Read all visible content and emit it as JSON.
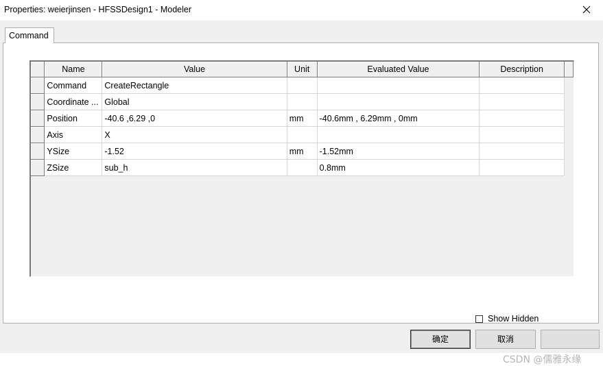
{
  "window": {
    "title": "Properties: weierjinsen - HFSSDesign1 - Modeler"
  },
  "tabs": [
    {
      "label": "Command"
    }
  ],
  "table": {
    "columns": [
      "Name",
      "Value",
      "Unit",
      "Evaluated Value",
      "Description"
    ],
    "rows": [
      {
        "name": "Command",
        "value": "CreateRectangle",
        "unit": "",
        "evaluated": "",
        "description": ""
      },
      {
        "name": "Coordinate ...",
        "value": "Global",
        "unit": "",
        "evaluated": "",
        "description": ""
      },
      {
        "name": "Position",
        "value": "-40.6 ,6.29 ,0",
        "unit": "mm",
        "evaluated": "-40.6mm , 6.29mm , 0mm",
        "description": ""
      },
      {
        "name": "Axis",
        "value": "X",
        "unit": "",
        "evaluated": "",
        "description": ""
      },
      {
        "name": "YSize",
        "value": "-1.52",
        "unit": "mm",
        "evaluated": "-1.52mm",
        "description": ""
      },
      {
        "name": "ZSize",
        "value": "sub_h",
        "unit": "",
        "evaluated": "0.8mm",
        "description": ""
      }
    ]
  },
  "show_hidden": {
    "label": "Show Hidden",
    "checked": false
  },
  "buttons": {
    "ok": "确定",
    "cancel": "取消"
  },
  "watermark": "CSDN @儒雅永缘"
}
